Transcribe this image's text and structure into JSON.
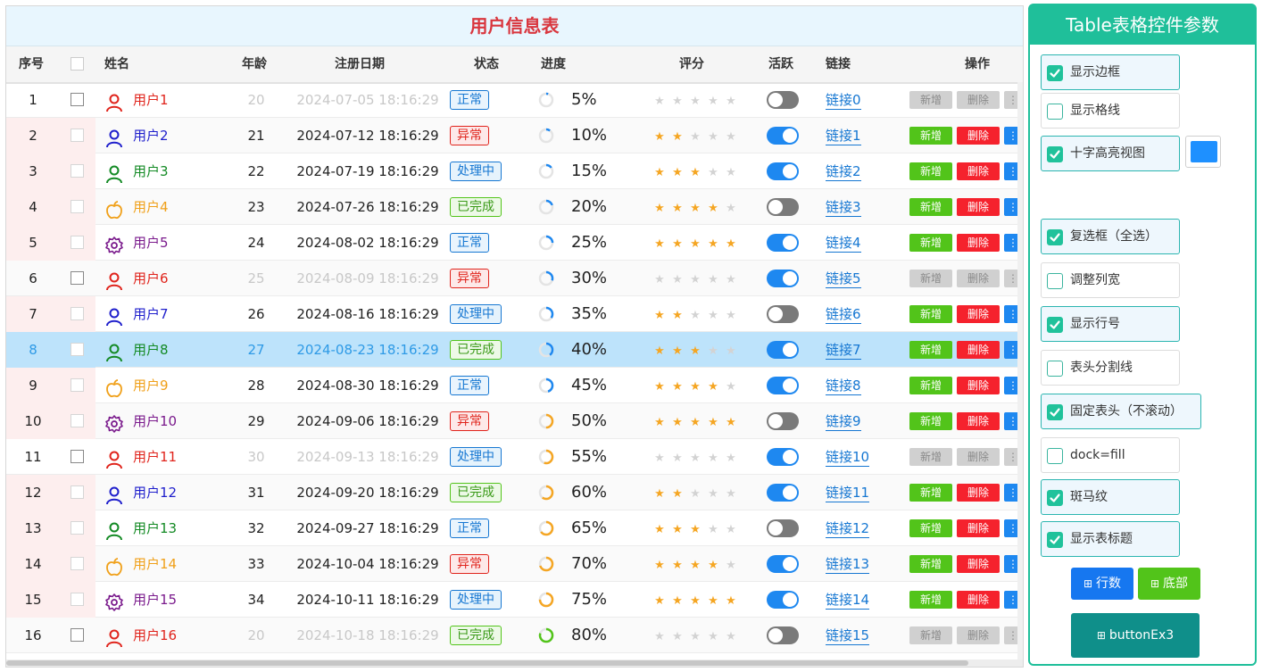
{
  "table": {
    "title": "用户信息表",
    "headers": {
      "index": "序号",
      "name": "姓名",
      "age": "年龄",
      "date": "注册日期",
      "status": "状态",
      "progress": "进度",
      "rating": "评分",
      "active": "活跃",
      "link": "链接",
      "ops": "操作"
    },
    "op_labels": {
      "add": "新增",
      "delete": "删除"
    },
    "selected_row": 8,
    "rows": [
      {
        "index": "1",
        "name": "用户1",
        "icon": "person-icon",
        "color": "#e0241c",
        "age": "20",
        "date": "2024-07-05 18:16:29",
        "status": "正常",
        "progress": "5%",
        "progress_value": 0.05,
        "rating": 0,
        "active": false,
        "link": "链接0",
        "enabled": false
      },
      {
        "index": "2",
        "name": "用户2",
        "icon": "person-icon",
        "color": "#1f1fcc",
        "age": "21",
        "date": "2024-07-12 18:16:29",
        "status": "异常",
        "progress": "10%",
        "progress_value": 0.1,
        "rating": 2,
        "active": true,
        "link": "链接1",
        "enabled": true
      },
      {
        "index": "3",
        "name": "用户3",
        "icon": "person-icon",
        "color": "#138a24",
        "age": "22",
        "date": "2024-07-19 18:16:29",
        "status": "处理中",
        "progress": "15%",
        "progress_value": 0.15,
        "rating": 3,
        "active": true,
        "link": "链接2",
        "enabled": true
      },
      {
        "index": "4",
        "name": "用户4",
        "icon": "apple-icon",
        "color": "#f0a019",
        "age": "23",
        "date": "2024-07-26 18:16:29",
        "status": "已完成",
        "progress": "20%",
        "progress_value": 0.2,
        "rating": 4,
        "active": false,
        "link": "链接3",
        "enabled": true
      },
      {
        "index": "5",
        "name": "用户5",
        "icon": "gear-icon",
        "color": "#7a1a8c",
        "age": "24",
        "date": "2024-08-02 18:16:29",
        "status": "正常",
        "progress": "25%",
        "progress_value": 0.25,
        "rating": 5,
        "active": true,
        "link": "链接4",
        "enabled": true
      },
      {
        "index": "6",
        "name": "用户6",
        "icon": "person-icon",
        "color": "#e0241c",
        "age": "25",
        "date": "2024-08-09 18:16:29",
        "status": "异常",
        "progress": "30%",
        "progress_value": 0.3,
        "rating": 0,
        "active": true,
        "link": "链接5",
        "enabled": false
      },
      {
        "index": "7",
        "name": "用户7",
        "icon": "person-icon",
        "color": "#1f1fcc",
        "age": "26",
        "date": "2024-08-16 18:16:29",
        "status": "处理中",
        "progress": "35%",
        "progress_value": 0.35,
        "rating": 2,
        "active": false,
        "link": "链接6",
        "enabled": true
      },
      {
        "index": "8",
        "name": "用户8",
        "icon": "person-icon",
        "color": "#138a24",
        "age": "27",
        "date": "2024-08-23 18:16:29",
        "status": "已完成",
        "progress": "40%",
        "progress_value": 0.4,
        "rating": 3,
        "active": true,
        "link": "链接7",
        "enabled": true
      },
      {
        "index": "9",
        "name": "用户9",
        "icon": "apple-icon",
        "color": "#f0a019",
        "age": "28",
        "date": "2024-08-30 18:16:29",
        "status": "正常",
        "progress": "45%",
        "progress_value": 0.45,
        "rating": 4,
        "active": true,
        "link": "链接8",
        "enabled": true
      },
      {
        "index": "10",
        "name": "用户10",
        "icon": "gear-icon",
        "color": "#7a1a8c",
        "age": "29",
        "date": "2024-09-06 18:16:29",
        "status": "异常",
        "progress": "50%",
        "progress_value": 0.5,
        "rating": 5,
        "active": false,
        "link": "链接9",
        "enabled": true
      },
      {
        "index": "11",
        "name": "用户11",
        "icon": "person-icon",
        "color": "#e0241c",
        "age": "30",
        "date": "2024-09-13 18:16:29",
        "status": "处理中",
        "progress": "55%",
        "progress_value": 0.55,
        "rating": 0,
        "active": true,
        "link": "链接10",
        "enabled": false
      },
      {
        "index": "12",
        "name": "用户12",
        "icon": "person-icon",
        "color": "#1f1fcc",
        "age": "31",
        "date": "2024-09-20 18:16:29",
        "status": "已完成",
        "progress": "60%",
        "progress_value": 0.6,
        "rating": 2,
        "active": true,
        "link": "链接11",
        "enabled": true
      },
      {
        "index": "13",
        "name": "用户13",
        "icon": "person-icon",
        "color": "#138a24",
        "age": "32",
        "date": "2024-09-27 18:16:29",
        "status": "正常",
        "progress": "65%",
        "progress_value": 0.65,
        "rating": 3,
        "active": false,
        "link": "链接12",
        "enabled": true
      },
      {
        "index": "14",
        "name": "用户14",
        "icon": "apple-icon",
        "color": "#f0a019",
        "age": "33",
        "date": "2024-10-04 18:16:29",
        "status": "异常",
        "progress": "70%",
        "progress_value": 0.7,
        "rating": 4,
        "active": true,
        "link": "链接13",
        "enabled": true
      },
      {
        "index": "15",
        "name": "用户15",
        "icon": "gear-icon",
        "color": "#7a1a8c",
        "age": "34",
        "date": "2024-10-11 18:16:29",
        "status": "处理中",
        "progress": "75%",
        "progress_value": 0.75,
        "rating": 5,
        "active": true,
        "link": "链接14",
        "enabled": true
      },
      {
        "index": "16",
        "name": "用户16",
        "icon": "person-icon",
        "color": "#e0241c",
        "age": "20",
        "date": "2024-10-18 18:16:29",
        "status": "已完成",
        "progress": "80%",
        "progress_value": 0.8,
        "rating": 0,
        "active": false,
        "link": "链接15",
        "enabled": false
      }
    ]
  },
  "status_styles": {
    "正常": {
      "text": "#1677d2",
      "border": "#1677d2",
      "bg": "#e9f4fd"
    },
    "异常": {
      "text": "#e0241c",
      "border": "#e0241c",
      "bg": "#fde9e9"
    },
    "处理中": {
      "text": "#1677d2",
      "border": "#1677d2",
      "bg": "#e6f3fc"
    },
    "已完成": {
      "text": "#3a9a18",
      "border": "#52c41a",
      "bg": "#edf9e7"
    }
  },
  "settings": {
    "title": "Table表格控件参数",
    "highlight_color": "#1e90ff",
    "options": [
      {
        "id": "show-border",
        "label": "显示边框",
        "checked": true
      },
      {
        "id": "show-gridlines",
        "label": "显示格线",
        "checked": false
      },
      {
        "id": "crosshair-highlight",
        "label": "十字高亮视图",
        "checked": true
      },
      {
        "id": "checkbox-select-all",
        "label": "复选框（全选）",
        "checked": true
      },
      {
        "id": "resize-columns",
        "label": "调整列宽",
        "checked": false
      },
      {
        "id": "show-row-numbers",
        "label": "显示行号",
        "checked": true
      },
      {
        "id": "header-divider",
        "label": "表头分割线",
        "checked": false
      },
      {
        "id": "fixed-header",
        "label": "固定表头（不滚动）",
        "checked": true
      },
      {
        "id": "dock-fill",
        "label": "dock=fill",
        "checked": false
      },
      {
        "id": "zebra-stripes",
        "label": "斑马纹",
        "checked": true
      },
      {
        "id": "show-table-title",
        "label": "显示表标题",
        "checked": true
      }
    ],
    "buttons": {
      "rows": "行数",
      "bottom": "底部",
      "ex3": "buttonEx3"
    }
  }
}
